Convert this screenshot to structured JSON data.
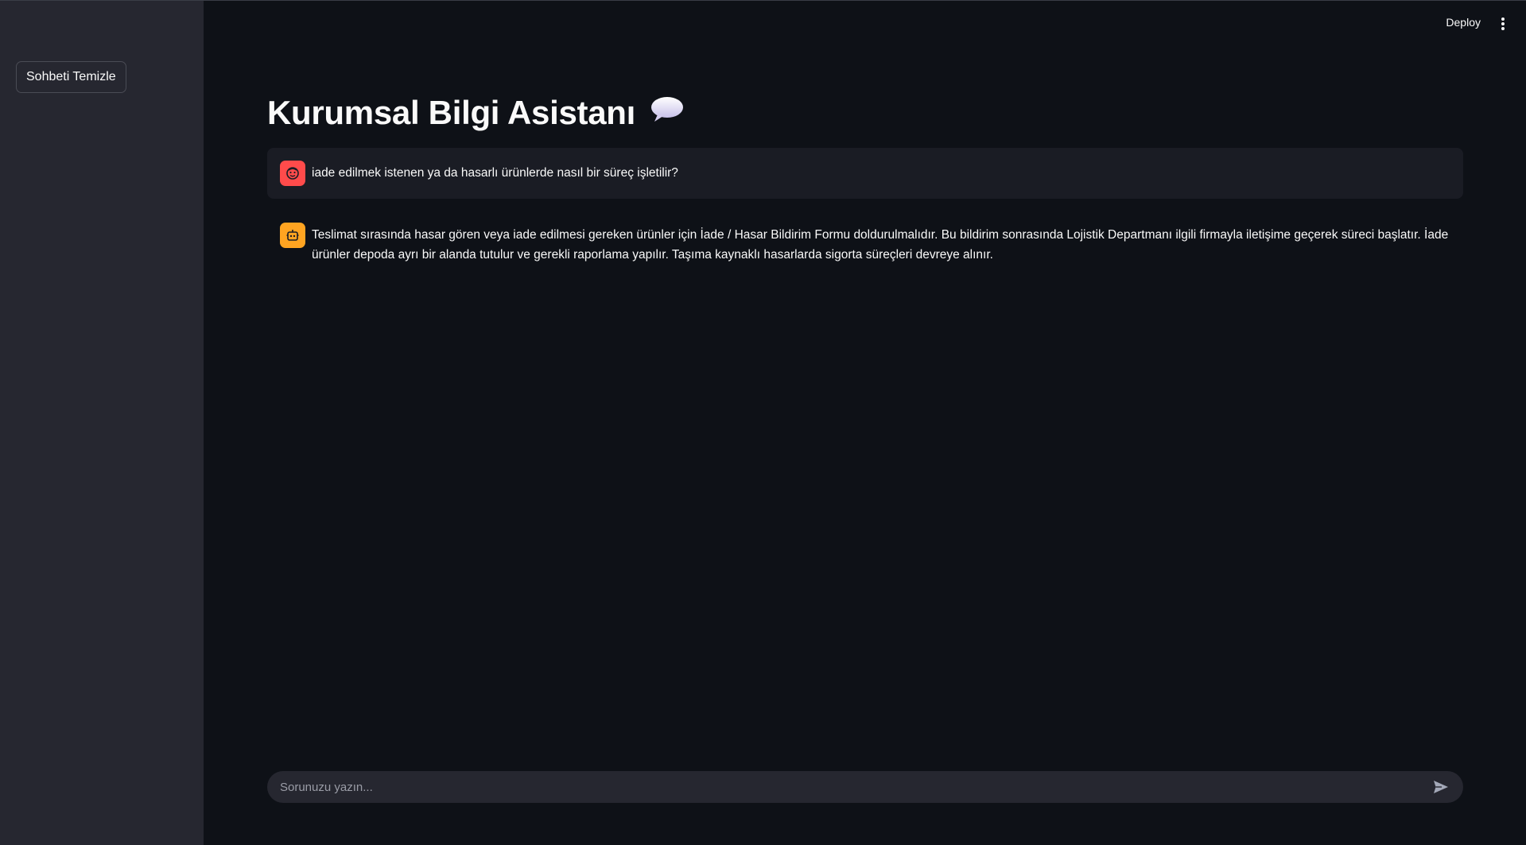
{
  "sidebar": {
    "clear_button_label": "Sohbeti Temizle"
  },
  "header": {
    "deploy_label": "Deploy",
    "menu_icon": "vertical-dots-icon"
  },
  "main": {
    "title": "Kurumsal Bilgi Asistanı",
    "title_icon": "speech-bubble-icon"
  },
  "messages": [
    {
      "role": "user",
      "avatar_icon": "user-face-icon",
      "text": "iade edilmek istenen ya da hasarlı ürünlerde nasıl bir süreç işletilir?"
    },
    {
      "role": "assistant",
      "avatar_icon": "robot-icon",
      "text": "Teslimat sırasında hasar gören veya iade edilmesi gereken ürünler için İade / Hasar Bildirim Formu doldurulmalıdır. Bu bildirim sonrasında Lojistik Departmanı ilgili firmayla iletişime geçerek süreci başlatır. İade ürünler depoda ayrı bir alanda tutulur ve gerekli raporlama yapılır. Taşıma kaynaklı hasarlarda sigorta süreçleri devreye alınır."
    }
  ],
  "chat_input": {
    "placeholder": "Sorunuzu yazın...",
    "value": "",
    "send_icon": "send-icon"
  },
  "colors": {
    "background": "#0e1117",
    "sidebar": "#262730",
    "user_avatar": "#ff4b4b",
    "assistant_avatar": "#ffa421"
  }
}
